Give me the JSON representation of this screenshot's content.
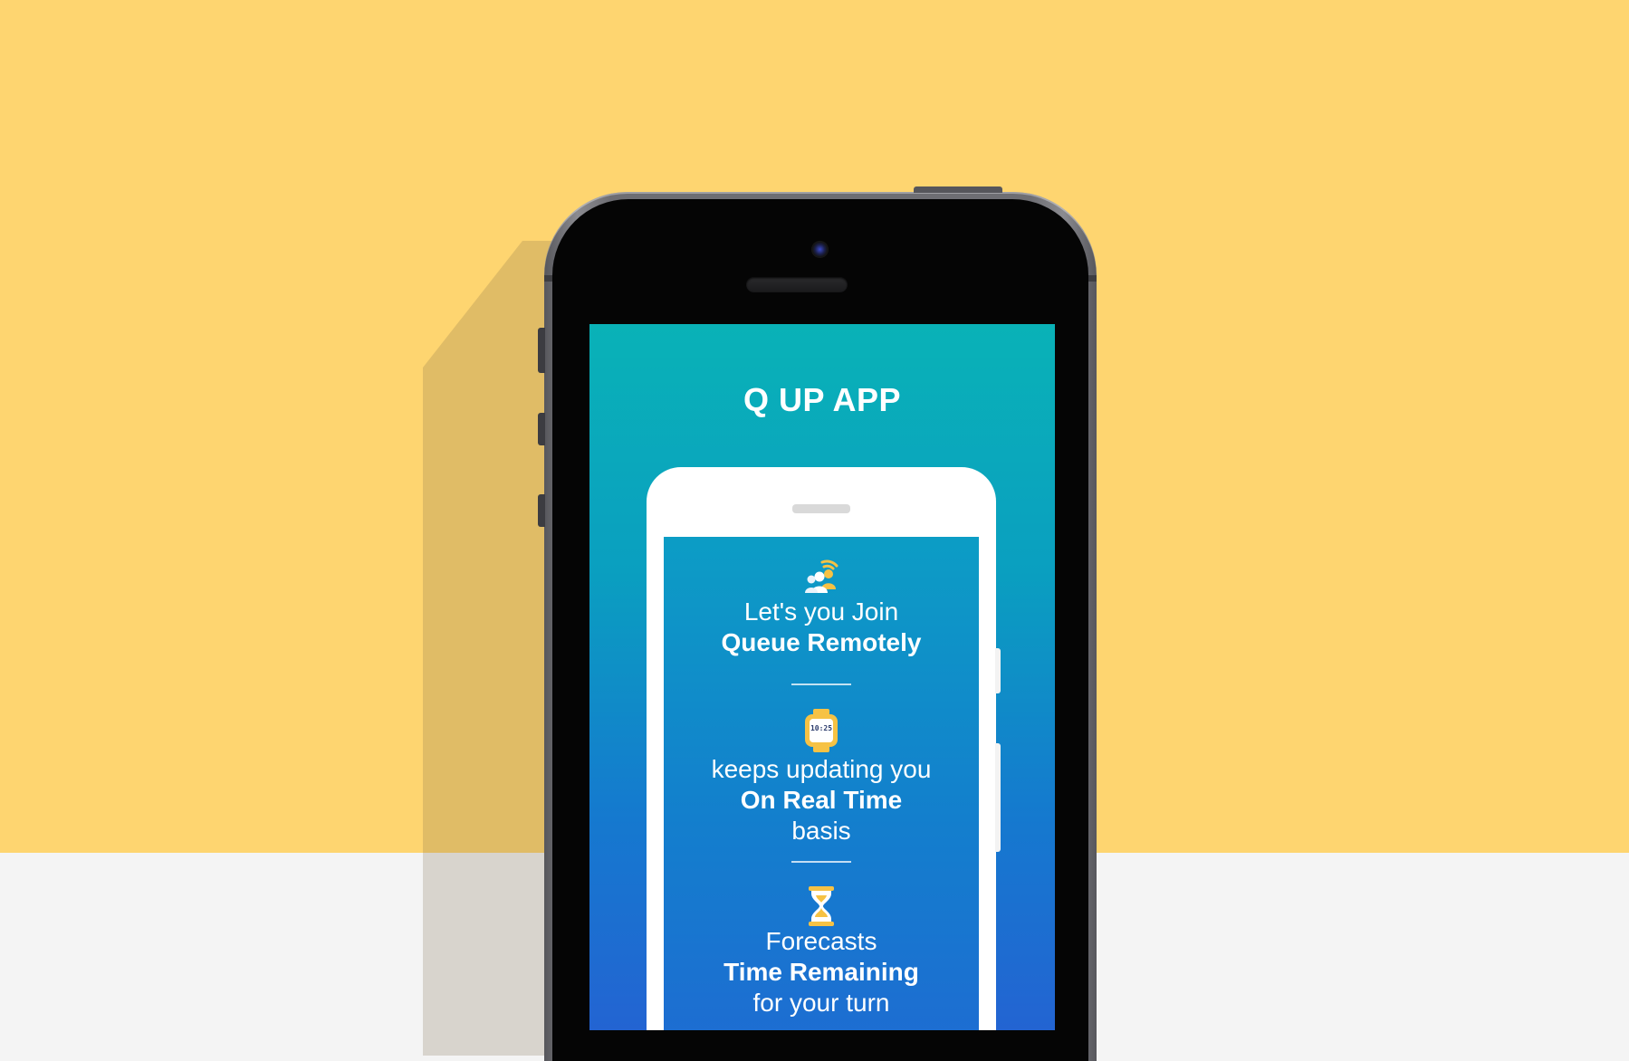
{
  "app": {
    "title": "Q UP APP"
  },
  "features": [
    {
      "icon": "remote-queue-people-icon",
      "line1": "Let's you Join",
      "line2": "Queue Remotely"
    },
    {
      "icon": "watch-clock-icon",
      "icon_text": "10:25",
      "line1": "keeps updating you",
      "line2": "On Real Time",
      "line3": "basis"
    },
    {
      "icon": "hourglass-icon",
      "line1": "Forecasts",
      "line2": "Time Remaining",
      "line3": "for your turn"
    }
  ],
  "colors": {
    "background_top": "#fed570",
    "background_bottom": "#f4f4f4",
    "screen_gradient_top": "#09b2b7",
    "screen_gradient_bottom": "#2364d2",
    "icon_yellow": "#f6c244"
  }
}
